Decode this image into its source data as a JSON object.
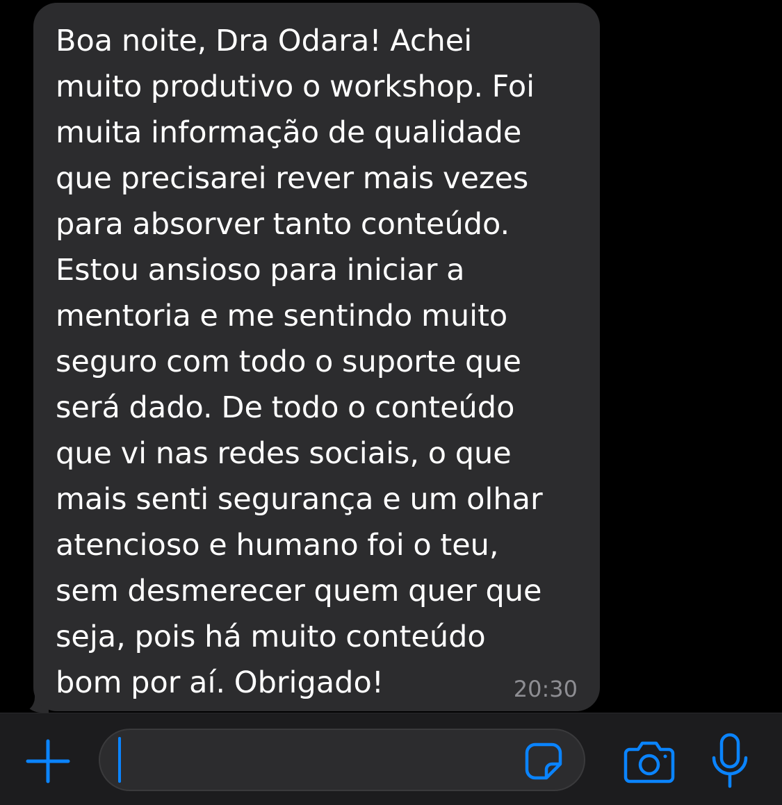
{
  "conversation": {
    "message": {
      "text": "Boa noite, Dra Odara! Achei\nmuito produtivo o workshop. Foi\nmuita informação de qualidade\nque precisarei rever mais vezes\npara absorver tanto conteúdo.\nEstou ansioso para iniciar a\nmentoria e me sentindo muito\nseguro com todo o suporte que\nserá dado. De todo o conteúdo\nque vi nas redes sociais, o que\nmais senti segurança e um olhar\natencioso e humano foi o teu,\nsem desmerecer quem quer que\nseja, pois há muito conteúdo\nbom por aí. Obrigado!",
      "time": "20:30"
    }
  },
  "composer": {
    "value": "",
    "icons": {
      "add": "plus-icon",
      "sticker": "sticker-icon",
      "camera": "camera-icon",
      "microphone": "microphone-icon"
    }
  },
  "colors": {
    "accent": "#0a84ff",
    "bubble": "#2c2c2e",
    "background": "#000000",
    "bar": "#1c1c1e",
    "timestamp": "#8e8e93"
  }
}
